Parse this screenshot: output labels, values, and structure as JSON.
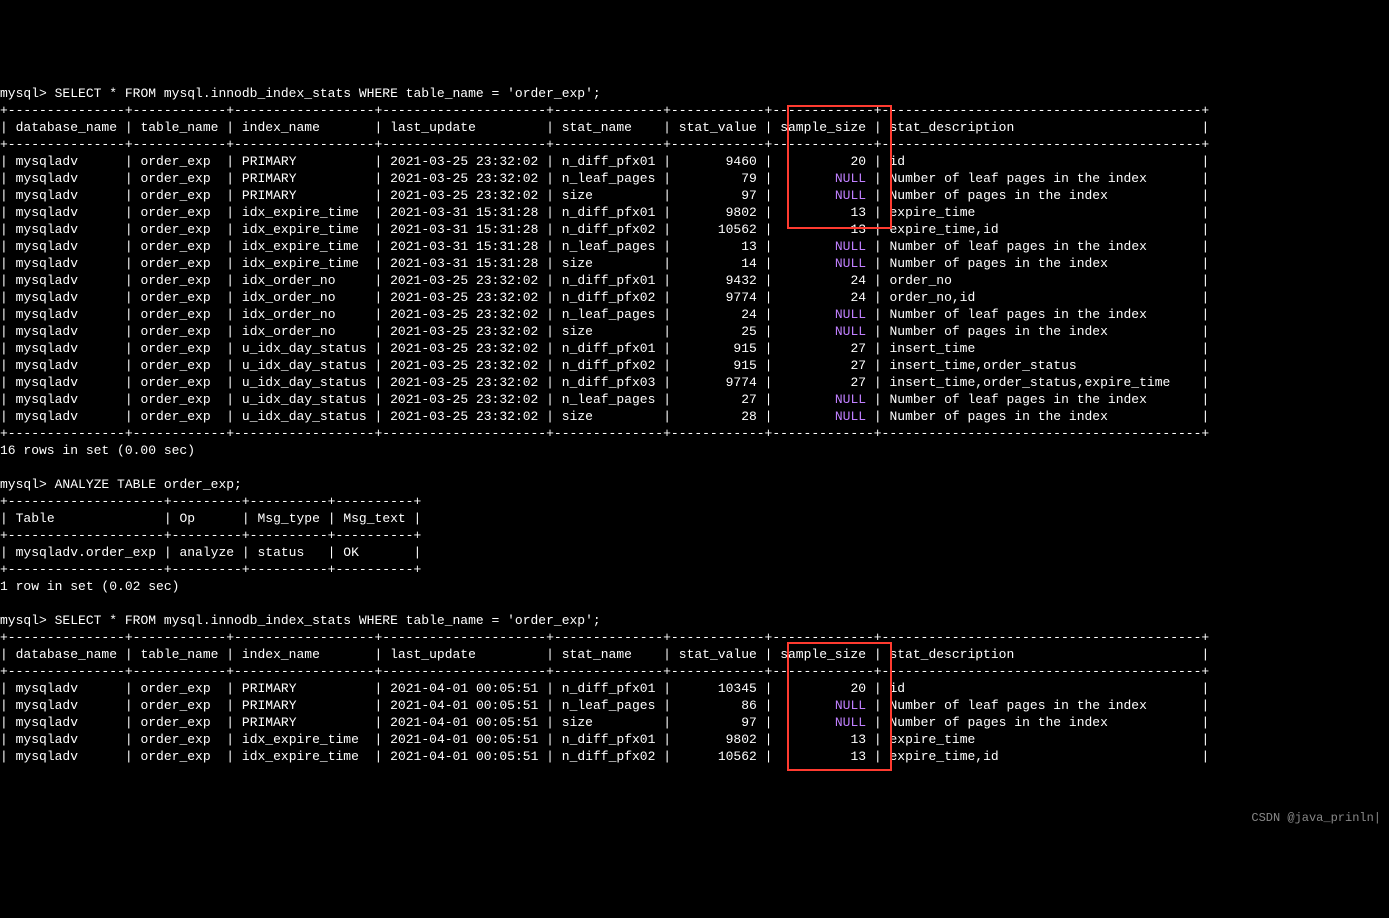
{
  "prompt": "mysql>",
  "query1": "SELECT * FROM mysql.innodb_index_stats WHERE table_name = 'order_exp';",
  "headers1": [
    "database_name",
    "table_name",
    "index_name",
    "last_update",
    "stat_name",
    "stat_value",
    "sample_size",
    "stat_description"
  ],
  "rows1": [
    [
      "mysqladv",
      "order_exp",
      "PRIMARY",
      "2021-03-25 23:32:02",
      "n_diff_pfx01",
      "9460",
      "20",
      "id"
    ],
    [
      "mysqladv",
      "order_exp",
      "PRIMARY",
      "2021-03-25 23:32:02",
      "n_leaf_pages",
      "79",
      "NULL",
      "Number of leaf pages in the index"
    ],
    [
      "mysqladv",
      "order_exp",
      "PRIMARY",
      "2021-03-25 23:32:02",
      "size",
      "97",
      "NULL",
      "Number of pages in the index"
    ],
    [
      "mysqladv",
      "order_exp",
      "idx_expire_time",
      "2021-03-31 15:31:28",
      "n_diff_pfx01",
      "9802",
      "13",
      "expire_time"
    ],
    [
      "mysqladv",
      "order_exp",
      "idx_expire_time",
      "2021-03-31 15:31:28",
      "n_diff_pfx02",
      "10562",
      "13",
      "expire_time,id"
    ],
    [
      "mysqladv",
      "order_exp",
      "idx_expire_time",
      "2021-03-31 15:31:28",
      "n_leaf_pages",
      "13",
      "NULL",
      "Number of leaf pages in the index"
    ],
    [
      "mysqladv",
      "order_exp",
      "idx_expire_time",
      "2021-03-31 15:31:28",
      "size",
      "14",
      "NULL",
      "Number of pages in the index"
    ],
    [
      "mysqladv",
      "order_exp",
      "idx_order_no",
      "2021-03-25 23:32:02",
      "n_diff_pfx01",
      "9432",
      "24",
      "order_no"
    ],
    [
      "mysqladv",
      "order_exp",
      "idx_order_no",
      "2021-03-25 23:32:02",
      "n_diff_pfx02",
      "9774",
      "24",
      "order_no,id"
    ],
    [
      "mysqladv",
      "order_exp",
      "idx_order_no",
      "2021-03-25 23:32:02",
      "n_leaf_pages",
      "24",
      "NULL",
      "Number of leaf pages in the index"
    ],
    [
      "mysqladv",
      "order_exp",
      "idx_order_no",
      "2021-03-25 23:32:02",
      "size",
      "25",
      "NULL",
      "Number of pages in the index"
    ],
    [
      "mysqladv",
      "order_exp",
      "u_idx_day_status",
      "2021-03-25 23:32:02",
      "n_diff_pfx01",
      "915",
      "27",
      "insert_time"
    ],
    [
      "mysqladv",
      "order_exp",
      "u_idx_day_status",
      "2021-03-25 23:32:02",
      "n_diff_pfx02",
      "915",
      "27",
      "insert_time,order_status"
    ],
    [
      "mysqladv",
      "order_exp",
      "u_idx_day_status",
      "2021-03-25 23:32:02",
      "n_diff_pfx03",
      "9774",
      "27",
      "insert_time,order_status,expire_time"
    ],
    [
      "mysqladv",
      "order_exp",
      "u_idx_day_status",
      "2021-03-25 23:32:02",
      "n_leaf_pages",
      "27",
      "NULL",
      "Number of leaf pages in the index"
    ],
    [
      "mysqladv",
      "order_exp",
      "u_idx_day_status",
      "2021-03-25 23:32:02",
      "size",
      "28",
      "NULL",
      "Number of pages in the index"
    ]
  ],
  "footer1": "16 rows in set (0.00 sec)",
  "query2": "ANALYZE TABLE order_exp;",
  "analyze_headers": [
    "Table",
    "Op",
    "Msg_type",
    "Msg_text"
  ],
  "analyze_row": [
    "mysqladv.order_exp",
    "analyze",
    "status",
    "OK"
  ],
  "footer2": "1 row in set (0.02 sec)",
  "query3": "SELECT * FROM mysql.innodb_index_stats WHERE table_name = 'order_exp';",
  "rows3": [
    [
      "mysqladv",
      "order_exp",
      "PRIMARY",
      "2021-04-01 00:05:51",
      "n_diff_pfx01",
      "10345",
      "20",
      "id"
    ],
    [
      "mysqladv",
      "order_exp",
      "PRIMARY",
      "2021-04-01 00:05:51",
      "n_leaf_pages",
      "86",
      "NULL",
      "Number of leaf pages in the index"
    ],
    [
      "mysqladv",
      "order_exp",
      "PRIMARY",
      "2021-04-01 00:05:51",
      "size",
      "97",
      "NULL",
      "Number of pages in the index"
    ],
    [
      "mysqladv",
      "order_exp",
      "idx_expire_time",
      "2021-04-01 00:05:51",
      "n_diff_pfx01",
      "9802",
      "13",
      "expire_time"
    ],
    [
      "mysqladv",
      "order_exp",
      "idx_expire_time",
      "2021-04-01 00:05:51",
      "n_diff_pfx02",
      "10562",
      "13",
      "expire_time,id"
    ]
  ],
  "watermark": "CSDN @java_prinln|"
}
